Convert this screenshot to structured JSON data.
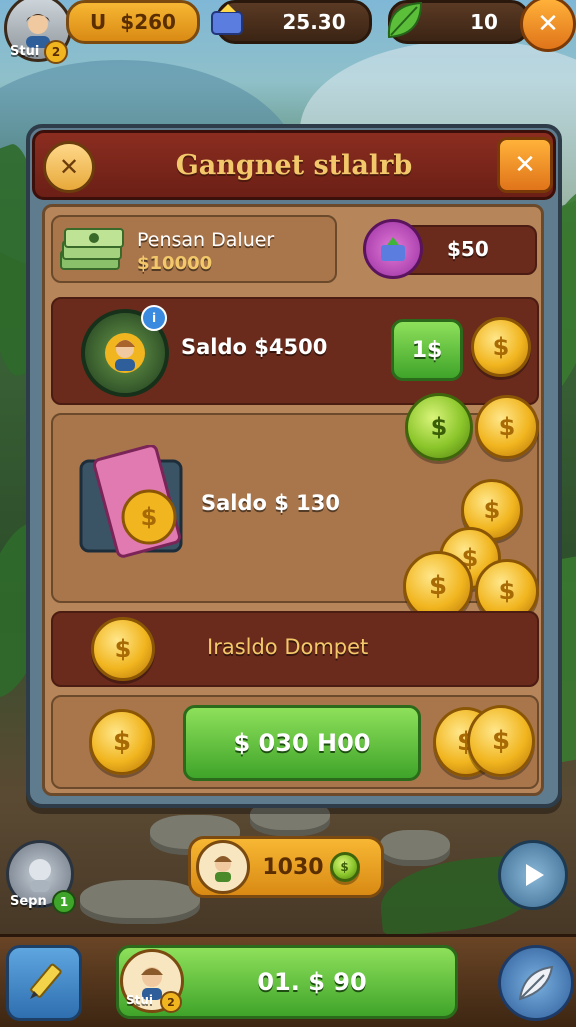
{
  "topbar": {
    "player_label": "Stui",
    "player_level": "2",
    "coins_value": "$260",
    "coins_prefix": "U",
    "gems_value": "25.30",
    "leaves_value": "10"
  },
  "panel": {
    "title": "Gangnet stlalrb",
    "rows": {
      "cash": {
        "label": "Pensan Daluer",
        "value": "$10000",
        "right_value": "$50"
      },
      "saldo1": {
        "label": "Saldo $4500",
        "button": "1$"
      },
      "saldo2": {
        "label": "Saldo $ 130"
      },
      "transfer": {
        "label": "Irasldo Dompet"
      },
      "action": {
        "button": "$ 030 H00"
      }
    }
  },
  "bottom": {
    "reward_value": "1030",
    "friend_label": "Sepn",
    "friend_level": "1",
    "balance_value": "01. $ 90",
    "player_label": "Stui",
    "player_level": "2"
  },
  "colors": {
    "gold": "#f1b51f",
    "green": "#3fa42a",
    "panel_red": "#6b1f16",
    "panel_title": "#f3c86a"
  },
  "icons": [
    "avatar",
    "coin-icon",
    "gem-box-icon",
    "leaf-icon",
    "close-icon",
    "back-icon",
    "cash-stack-icon",
    "coin-badge-icon",
    "card-icon",
    "play-icon",
    "pencil-icon",
    "feather-icon"
  ]
}
